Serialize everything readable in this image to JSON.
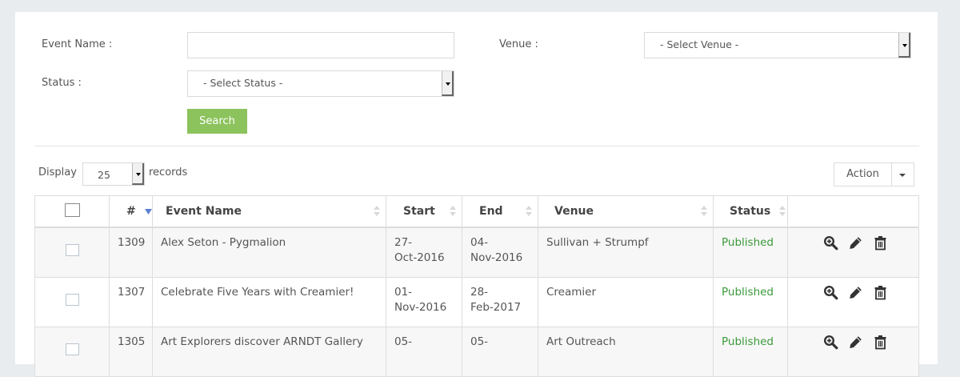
{
  "filters": {
    "event_name_label": "Event Name :",
    "event_name_value": "",
    "venue_label": "Venue :",
    "venue_value": "- Select Venue -",
    "status_label": "Status :",
    "status_value": "- Select Status -",
    "search_label": "Search"
  },
  "list": {
    "display_label": "Display",
    "page_size": "25",
    "records_label": "records",
    "action_label": "Action"
  },
  "table": {
    "headers": {
      "num": "#",
      "event": "Event Name",
      "start": "Start",
      "end": "End",
      "venue": "Venue",
      "status": "Status"
    },
    "rows": [
      {
        "id": "1309",
        "event": "Alex Seton - Pygmalion",
        "start": "27-\nOct-2016",
        "end": "04-\nNov-2016",
        "venue": "Sullivan + Strumpf",
        "status": "Published"
      },
      {
        "id": "1307",
        "event": "Celebrate Five Years with Creamier!",
        "start": "01-\nNov-2016",
        "end": "28-\nFeb-2017",
        "venue": "Creamier",
        "status": "Published"
      },
      {
        "id": "1305",
        "event": "Art Explorers discover ARNDT Gallery",
        "start": "05-",
        "end": "05-",
        "venue": "Art Outreach",
        "status": "Published"
      }
    ]
  },
  "colors": {
    "search_button": "#8cc35d",
    "published": "#3a9a3a",
    "sort_active": "#5b7fd4"
  },
  "icons": [
    "zoom-in-icon",
    "pencil-icon",
    "trash-icon"
  ]
}
